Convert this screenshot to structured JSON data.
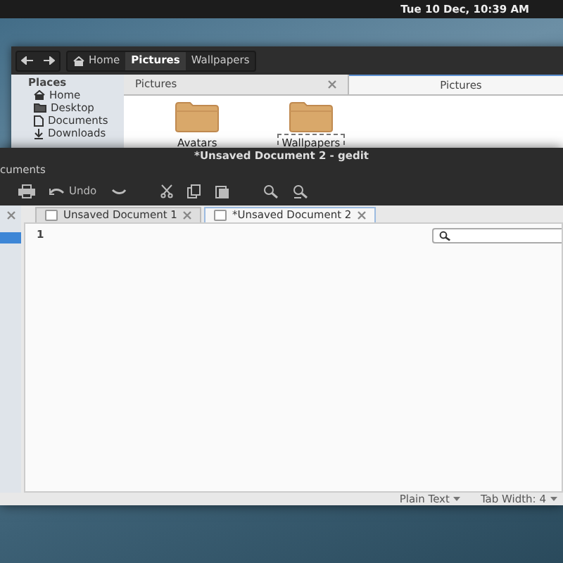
{
  "top_panel": {
    "clock": "Tue 10 Dec, 10:39 AM"
  },
  "files_window": {
    "breadcrumbs": [
      {
        "label": "Home",
        "kind": "home",
        "selected": false
      },
      {
        "label": "Pictures",
        "kind": "plain",
        "selected": true
      },
      {
        "label": "Wallpapers",
        "kind": "plain",
        "selected": false
      }
    ],
    "sidebar": {
      "heading": "Places",
      "items": [
        {
          "label": "Home",
          "kind": "home"
        },
        {
          "label": "Desktop",
          "kind": "folder"
        },
        {
          "label": "Documents",
          "kind": "document"
        },
        {
          "label": "Downloads",
          "kind": "download"
        }
      ]
    },
    "tabs": [
      {
        "label": "Pictures",
        "selected": false
      },
      {
        "label": "Pictures",
        "selected": true
      }
    ],
    "items": [
      {
        "label": "Avatars",
        "selected": false
      },
      {
        "label": "Wallpapers",
        "selected": true
      }
    ]
  },
  "gedit_window": {
    "title": "*Unsaved Document 2 - gedit",
    "side_panel": {
      "title": "cuments",
      "rows": [
        {
          "selected": true
        }
      ]
    },
    "toolbar": [
      {
        "kind": "print"
      },
      {
        "kind": "undo",
        "label": "Undo"
      },
      {
        "kind": "redo"
      },
      {
        "kind": "cut"
      },
      {
        "kind": "copy"
      },
      {
        "kind": "paste"
      },
      {
        "kind": "find"
      },
      {
        "kind": "replace"
      }
    ],
    "tabs": [
      {
        "label": "Unsaved Document 1",
        "selected": false
      },
      {
        "label": "*Unsaved Document 2",
        "selected": true
      }
    ],
    "line_numbers": [
      "1"
    ],
    "status_bar": [
      {
        "label": "Plain Text"
      },
      {
        "label": "Tab Width: 4"
      }
    ]
  }
}
